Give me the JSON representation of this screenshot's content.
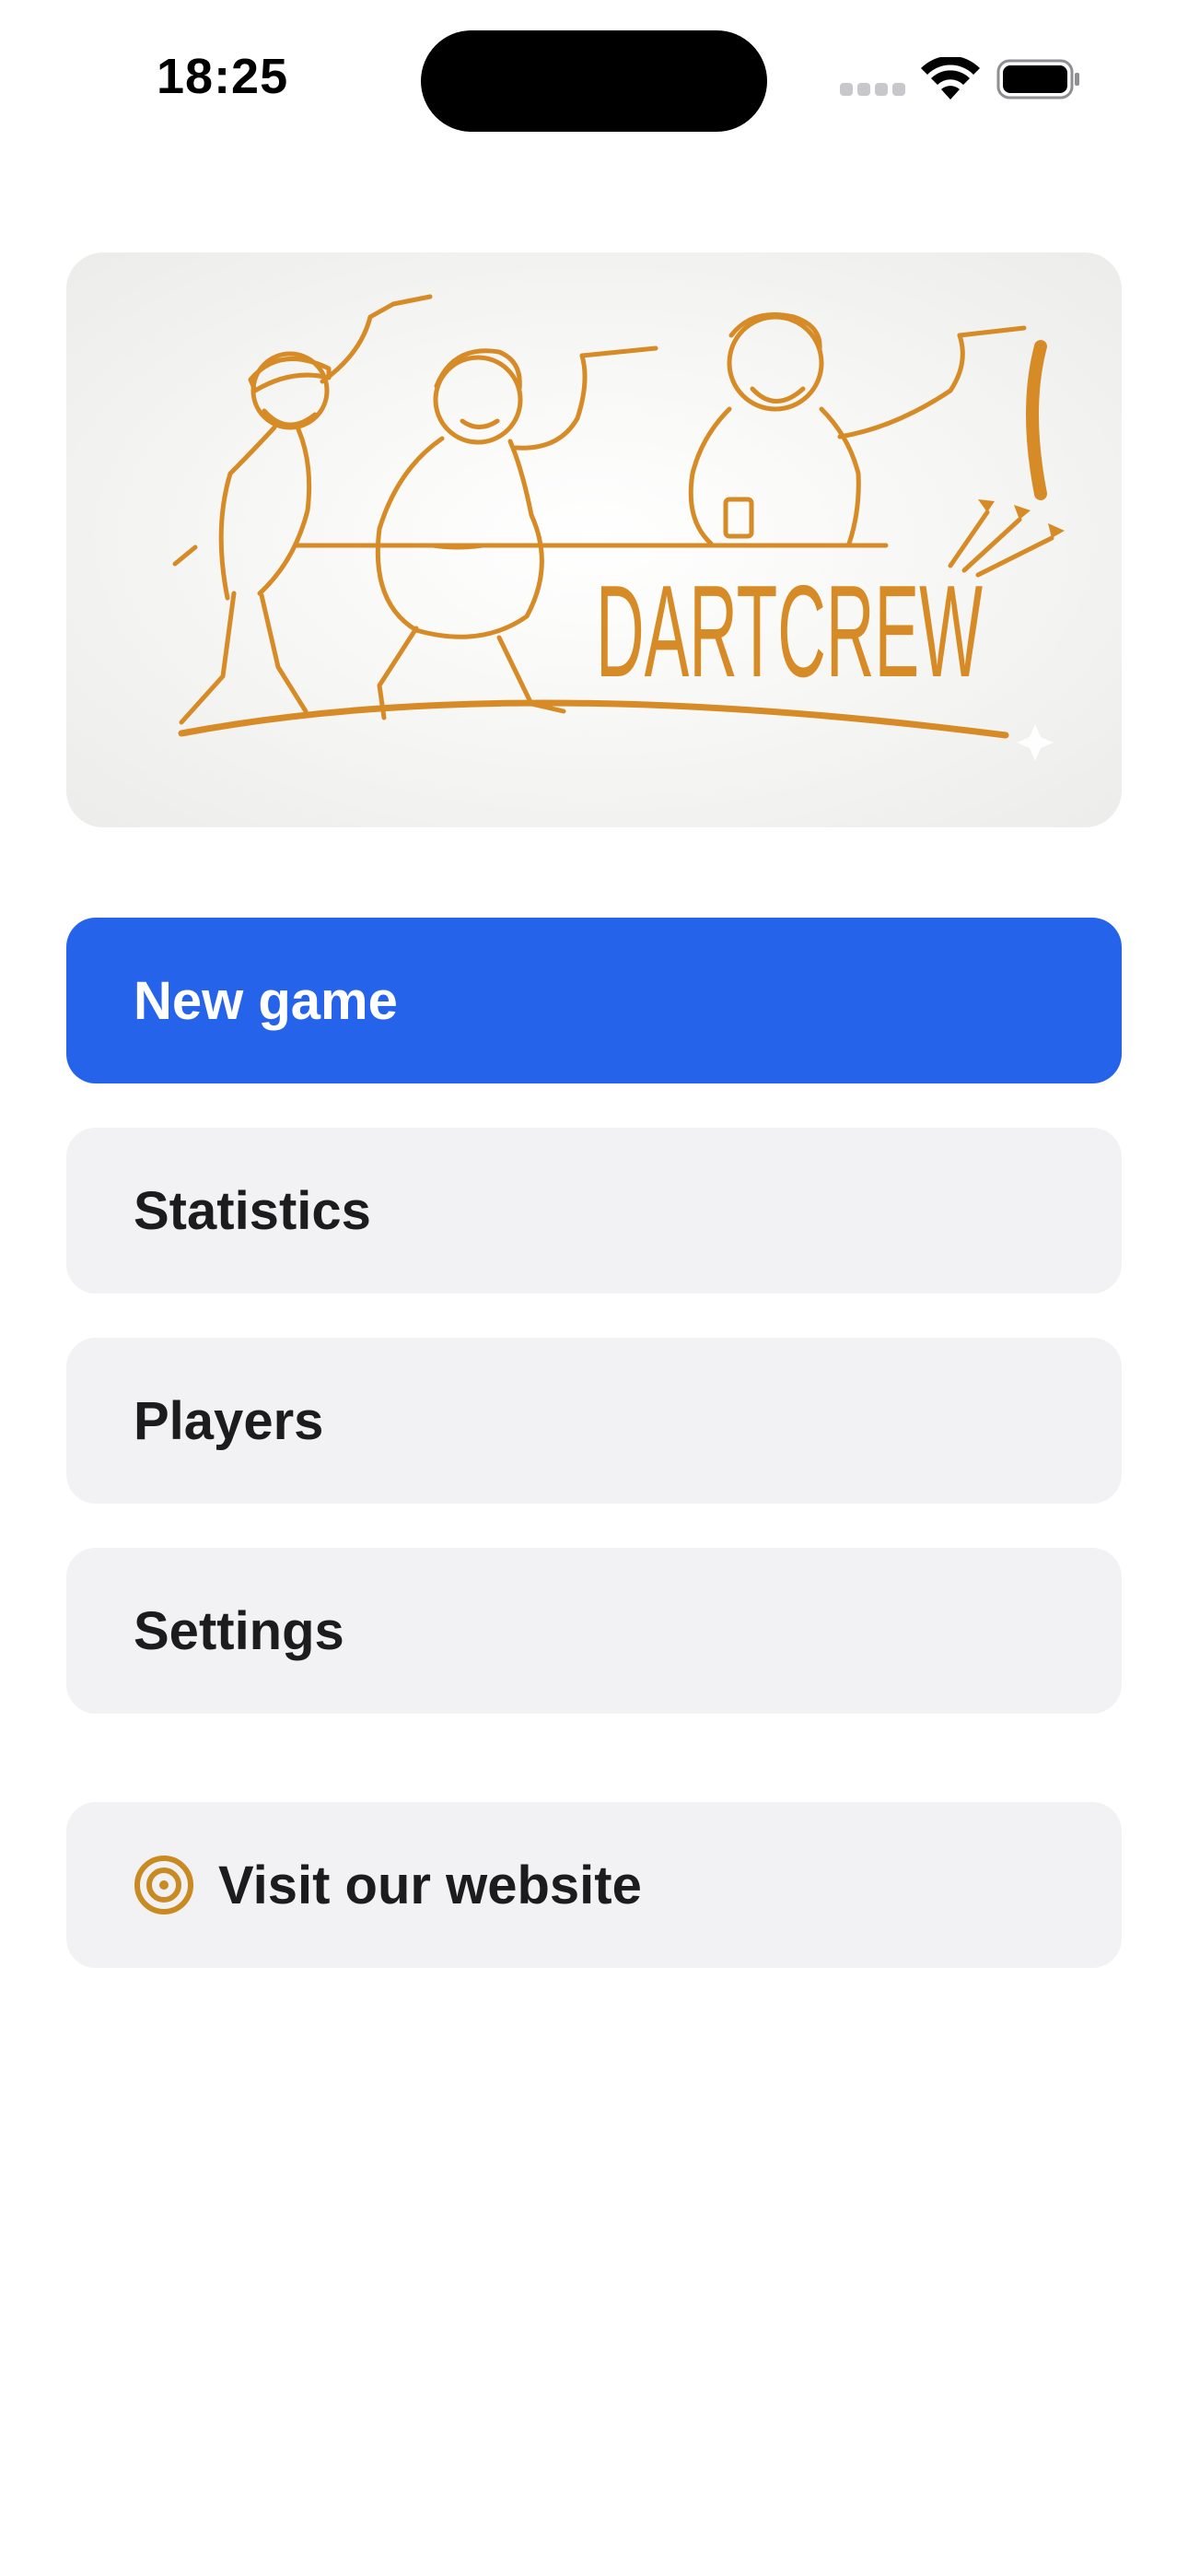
{
  "status_bar": {
    "time": "18:25"
  },
  "hero": {
    "brand": "DARTCREW",
    "accent_color": "#D68B27"
  },
  "menu": {
    "new_game": "New game",
    "statistics": "Statistics",
    "players": "Players",
    "settings": "Settings",
    "website": "Visit our website"
  },
  "colors": {
    "primary": "#2563EB",
    "button_bg": "#F2F2F4",
    "text": "#1C1C1E"
  },
  "icons": {
    "website": "target-icon"
  }
}
